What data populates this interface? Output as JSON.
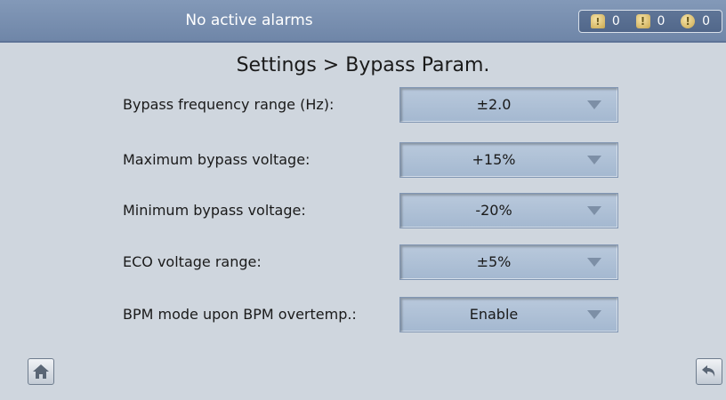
{
  "header": {
    "alarm_status": "No active alarms",
    "counters": [
      {
        "icon": "bell-alarm-icon",
        "count": "0"
      },
      {
        "icon": "exclamation-square-icon",
        "count": "0"
      },
      {
        "icon": "exclamation-circle-icon",
        "count": "0"
      }
    ]
  },
  "page": {
    "title": "Settings > Bypass Param."
  },
  "params": [
    {
      "label": "Bypass frequency range (Hz):",
      "value": "±2.0"
    },
    {
      "label": "Maximum bypass voltage:",
      "value": "+15%"
    },
    {
      "label": "Minimum bypass voltage:",
      "value": "-20%"
    },
    {
      "label": "ECO voltage range:",
      "value": "±5%"
    },
    {
      "label": "BPM mode upon BPM overtemp.:",
      "value": "Enable"
    }
  ],
  "nav": {
    "home_icon": "home-icon",
    "back_icon": "back-arrow-icon"
  },
  "colors": {
    "background": "#cfd6de",
    "header": "#7890b0",
    "dropdown": "#b0c2d8"
  }
}
